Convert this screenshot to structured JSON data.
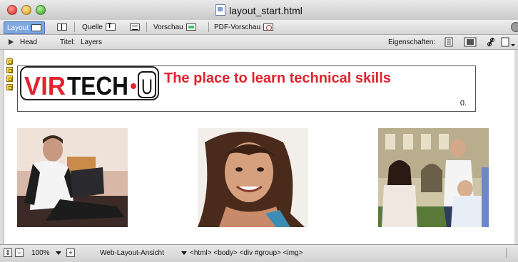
{
  "window": {
    "title": "layout_start.html"
  },
  "toolbar": {
    "layout_label": "Layout",
    "source_label": "Quelle",
    "preview_label": "Vorschau",
    "pdf_preview_label": "PDF-Vorschau"
  },
  "infobar": {
    "head_label": "Head",
    "title_label": "Titel:",
    "title_value": "Layers",
    "properties_label": "Eigenschaften:"
  },
  "content": {
    "logo_text": "VIRTECH•U",
    "tagline": "The place to learn technical skills",
    "corner_text": "0."
  },
  "statusbar": {
    "zoom": "100%",
    "view_mode": "Web-Layout-Ansicht",
    "breadcrumb": "<html> <body> <div #group> <img>"
  },
  "colors": {
    "accent": "#7fa7e0",
    "brand_red": "#e0242f"
  }
}
